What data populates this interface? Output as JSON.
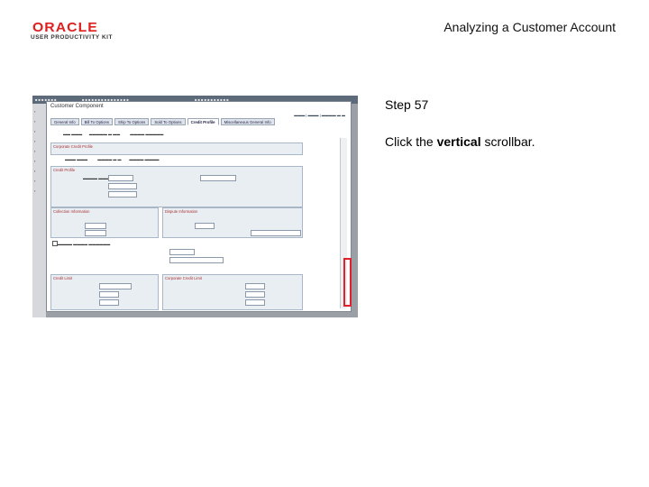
{
  "header": {
    "logo_brand": "ORACLE",
    "logo_product": "USER PRODUCTIVITY KIT",
    "title": "Analyzing a Customer Account"
  },
  "step": {
    "label": "Step 57",
    "instruction_pre": "Click the ",
    "instruction_bold": "vertical",
    "instruction_post": " scrollbar."
  },
  "screenshot": {
    "modal_title": "Customer Component",
    "tabs": [
      "General Info",
      "Bill To Options",
      "Ship To Options",
      "Sold To Options",
      "Credit Profile",
      "Miscellaneous General Info"
    ],
    "active_tab": "Credit Profile",
    "sections": [
      "Corporate Credit Profile",
      "Credit Profile",
      "Collection Information",
      "Dispute Information",
      "Credit Limit",
      "Corporate Credit Limit"
    ]
  },
  "colors": {
    "highlight": "#e0202a",
    "logo_red": "#e01f1f"
  }
}
